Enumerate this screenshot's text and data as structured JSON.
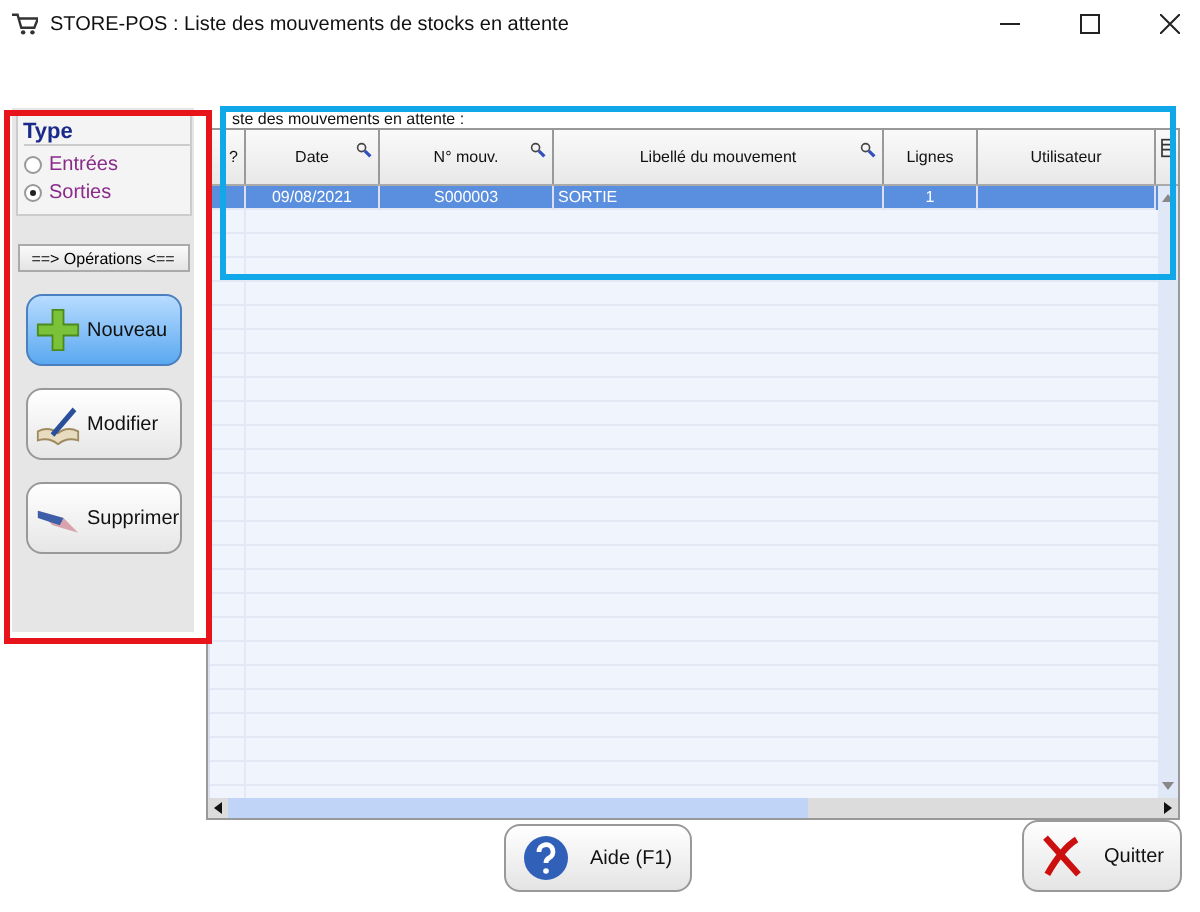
{
  "window": {
    "title": "STORE-POS : Liste des mouvements de stocks en attente"
  },
  "type_group": {
    "title": "Type",
    "options": [
      {
        "label": "Entrées",
        "selected": false
      },
      {
        "label": "Sorties",
        "selected": true
      }
    ]
  },
  "operations_header": "==> Opérations <==",
  "actions": [
    {
      "label": "Nouveau",
      "kind": "add",
      "selected": true
    },
    {
      "label": "Modifier",
      "kind": "edit",
      "selected": false
    },
    {
      "label": "Supprimer",
      "kind": "delete",
      "selected": false
    }
  ],
  "list_label": "ste des mouvements en attente :",
  "table": {
    "columns": [
      {
        "label": "?",
        "searchable": false
      },
      {
        "label": "Date",
        "searchable": true
      },
      {
        "label": "N° mouv.",
        "searchable": true
      },
      {
        "label": "Libellé du mouvement",
        "searchable": true
      },
      {
        "label": "Lignes",
        "searchable": false
      },
      {
        "label": "Utilisateur",
        "searchable": false
      }
    ],
    "rows": [
      {
        "selected": true,
        "cells": [
          "",
          "09/08/2021",
          "S000003",
          "SORTIE",
          "1",
          ""
        ]
      }
    ]
  },
  "buttons": [
    {
      "label": "Aide (F1)",
      "kind": "help"
    },
    {
      "label": "Quitter",
      "kind": "quit"
    }
  ]
}
